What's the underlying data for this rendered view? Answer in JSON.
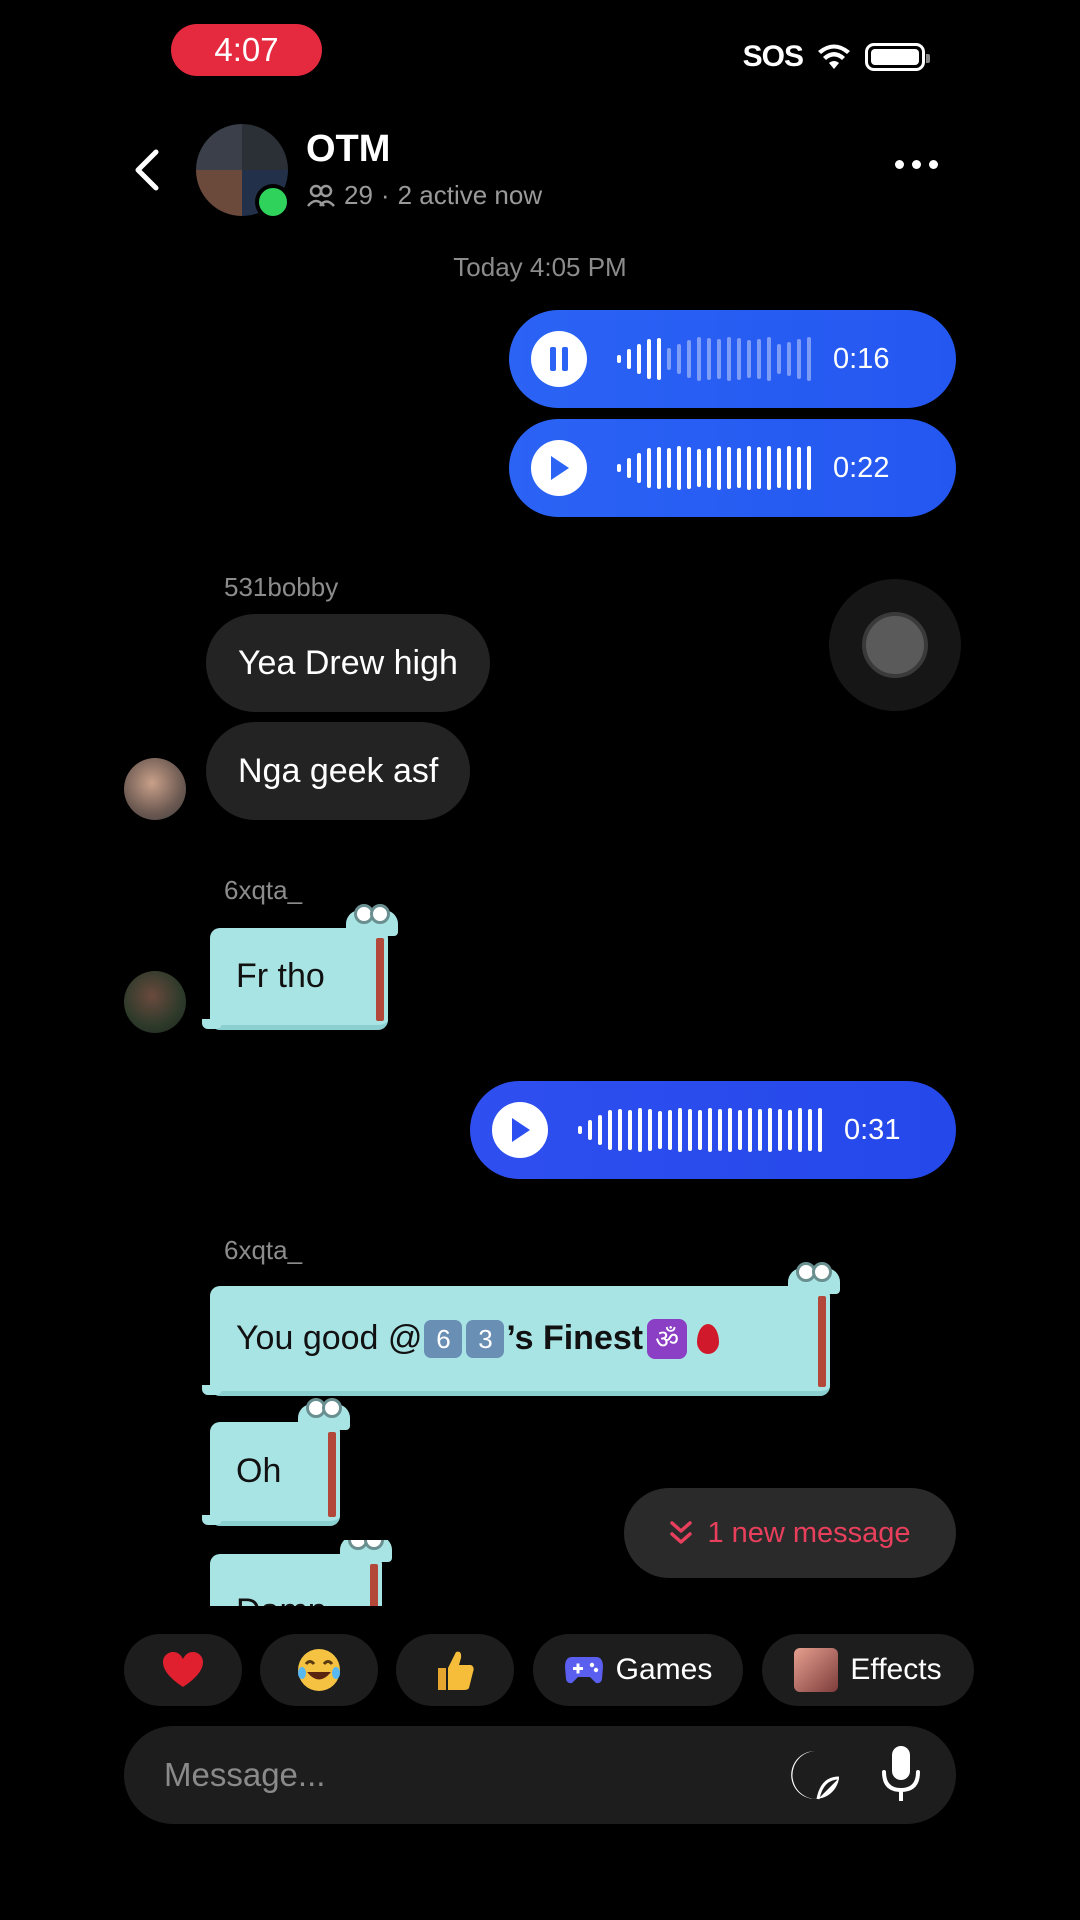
{
  "status_bar": {
    "time": "4:07",
    "carrier": "SOS"
  },
  "header": {
    "title": "OTM",
    "member_count": "29",
    "active": "2 active now"
  },
  "timestamp": "Today 4:05 PM",
  "voice_messages": [
    {
      "state": "playing",
      "duration": "0:16"
    },
    {
      "state": "paused",
      "duration": "0:22"
    },
    {
      "state": "paused",
      "duration": "0:31"
    }
  ],
  "messages": {
    "group1": {
      "sender": "531bobby",
      "lines": [
        "Yea Drew high",
        "Nga geek asf"
      ]
    },
    "group2": {
      "sender": "6xqta_",
      "lines": [
        "Fr tho"
      ]
    },
    "group3": {
      "sender": "6xqta_",
      "mention_prefix": "You good @",
      "keycaps": [
        "6",
        "3"
      ],
      "mention_suffix": "’s Finest",
      "om": "ॐ",
      "lines": [
        "Oh",
        "Damn"
      ]
    }
  },
  "new_message_pill": "1 new message",
  "quick_actions": {
    "games": "Games",
    "effects": "Effects"
  },
  "composer": {
    "placeholder": "Message..."
  },
  "colors": {
    "accent": "#2b63f5",
    "alert": "#e8405c",
    "sticker": "#a9e4e5"
  }
}
